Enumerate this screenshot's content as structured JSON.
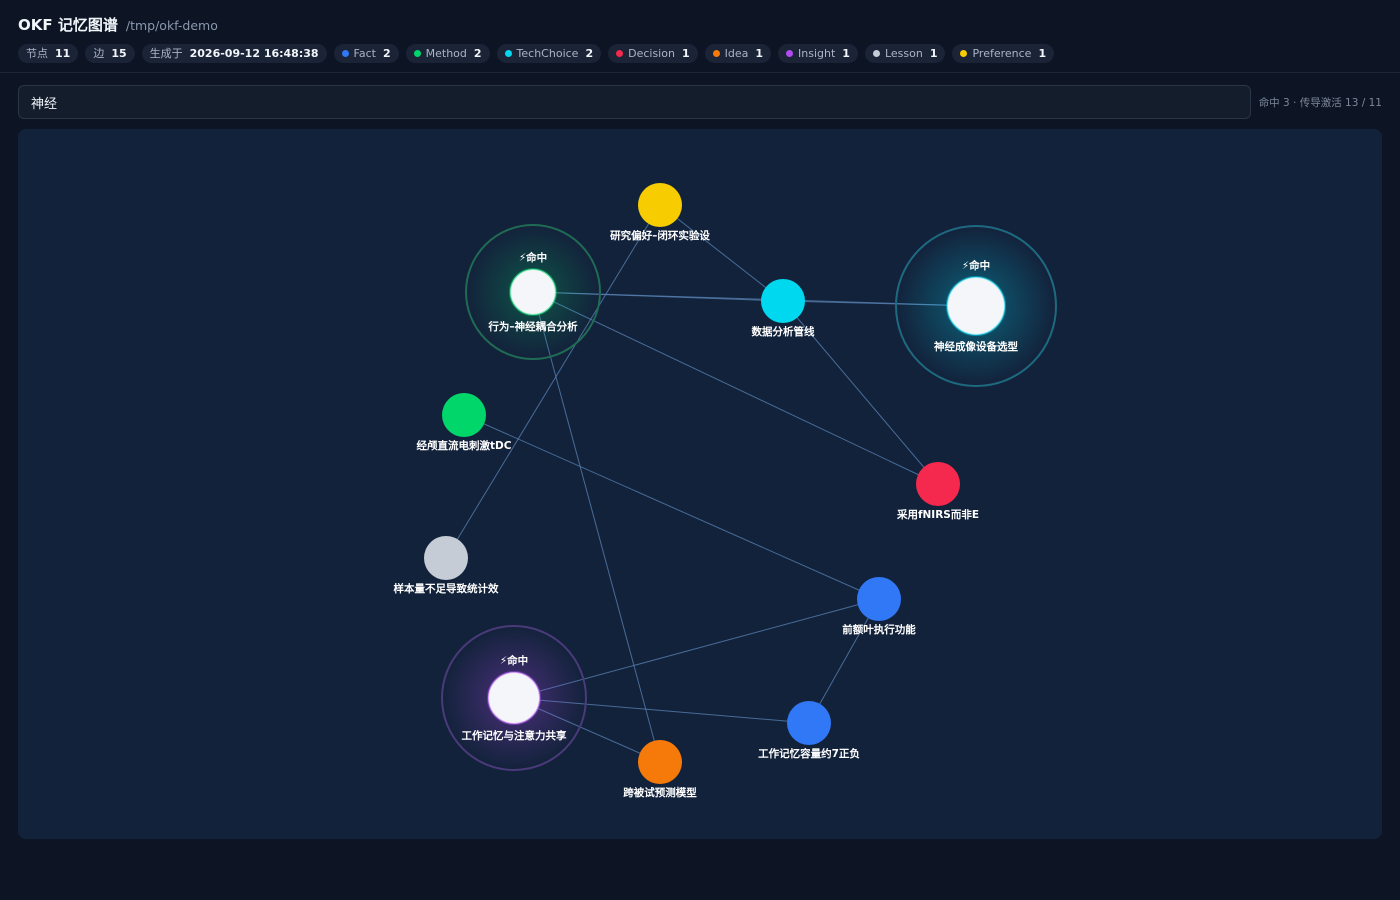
{
  "header": {
    "title": "OKF 记忆图谱",
    "path": "/tmp/okf-demo"
  },
  "stats": {
    "nodes_label": "节点",
    "nodes_value": "11",
    "edges_label": "边",
    "edges_value": "15",
    "generated_label": "生成于",
    "generated_value": "2026-09-12 16:48:38"
  },
  "types": [
    {
      "name": "Fact",
      "count": "2",
      "color": "#3178f6"
    },
    {
      "name": "Method",
      "count": "2",
      "color": "#00d66a"
    },
    {
      "name": "TechChoice",
      "count": "2",
      "color": "#00d8f0"
    },
    {
      "name": "Decision",
      "count": "1",
      "color": "#f5284d"
    },
    {
      "name": "Idea",
      "count": "1",
      "color": "#f57a0a"
    },
    {
      "name": "Insight",
      "count": "1",
      "color": "#b04bf2"
    },
    {
      "name": "Lesson",
      "count": "1",
      "color": "#c6ccd6"
    },
    {
      "name": "Preference",
      "count": "1",
      "color": "#f7cc00"
    }
  ],
  "search": {
    "value": "神经",
    "status": "命中 3 · 传导激活 13 / 11"
  },
  "graph": {
    "hit_label": "⚡命中",
    "nodes": [
      {
        "id": "pref",
        "label": "研究偏好–闭环实验设",
        "type": "Preference",
        "color": "#f7cc00",
        "hit": false
      },
      {
        "id": "behav",
        "label": "行为–神经耦合分析",
        "type": "Method",
        "color": "#00d66a",
        "hit": true
      },
      {
        "id": "pipe",
        "label": "数据分析管线",
        "type": "TechChoice",
        "color": "#00d8f0",
        "hit": false
      },
      {
        "id": "img",
        "label": "神经成像设备选型",
        "type": "TechChoice",
        "color": "#00d8f0",
        "hit": true
      },
      {
        "id": "tdc",
        "label": "经颅直流电刺激tDC",
        "type": "Method",
        "color": "#00d66a",
        "hit": false
      },
      {
        "id": "fnirs",
        "label": "采用fNIRS而非E",
        "type": "Decision",
        "color": "#f5284d",
        "hit": false
      },
      {
        "id": "sample",
        "label": "样本量不足导致统计效",
        "type": "Lesson",
        "color": "#c6ccd6",
        "hit": false
      },
      {
        "id": "pfc",
        "label": "前额叶执行功能",
        "type": "Fact",
        "color": "#3178f6",
        "hit": false
      },
      {
        "id": "wm",
        "label": "工作记忆与注意力共享",
        "type": "Insight",
        "color": "#b04bf2",
        "hit": true
      },
      {
        "id": "cap",
        "label": "工作记忆容量约7正负",
        "type": "Fact",
        "color": "#3178f6",
        "hit": false
      },
      {
        "id": "cross",
        "label": "跨被试预测模型",
        "type": "Idea",
        "color": "#f57a0a",
        "hit": false
      }
    ],
    "edges": [
      [
        "behav",
        "pipe"
      ],
      [
        "behav",
        "img"
      ],
      [
        "behav",
        "fnirs"
      ],
      [
        "behav",
        "cross"
      ],
      [
        "pref",
        "pipe"
      ],
      [
        "pref",
        "sample"
      ],
      [
        "pipe",
        "fnirs"
      ],
      [
        "pipe",
        "img"
      ],
      [
        "tdc",
        "pfc"
      ],
      [
        "pfc",
        "wm"
      ],
      [
        "pfc",
        "cap"
      ],
      [
        "wm",
        "cap"
      ],
      [
        "wm",
        "cross"
      ]
    ]
  }
}
